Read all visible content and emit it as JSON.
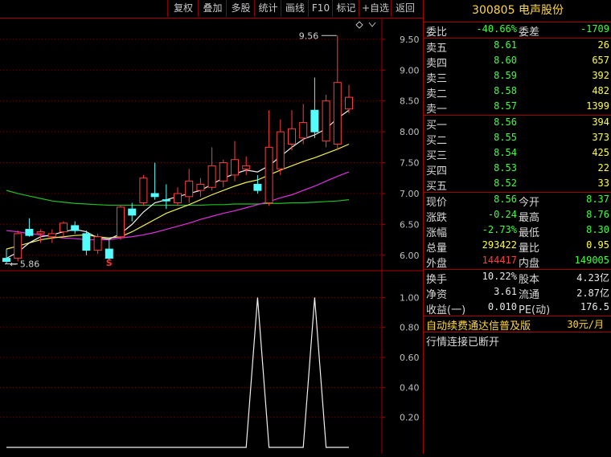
{
  "toolbar": {
    "buttons": [
      "复权",
      "叠加",
      "多股",
      "统计",
      "画线",
      "F10",
      "标记",
      "+自选",
      "返回"
    ]
  },
  "chart": {
    "price_axis_labels": [
      "9.50",
      "9.00",
      "8.50",
      "8.00",
      "7.50",
      "7.00",
      "6.50",
      "6.00"
    ],
    "indicator_axis_labels": [
      "1.00",
      "0.80",
      "0.60",
      "0.40",
      "0.20"
    ],
    "high_marker": "9.56",
    "low_marker": "5.86",
    "signal_marker": "S"
  },
  "chart_data": {
    "type": "candlestick",
    "candles": [
      {
        "o": 5.95,
        "h": 6.1,
        "l": 5.86,
        "c": 5.9
      },
      {
        "o": 5.95,
        "h": 6.4,
        "l": 5.9,
        "c": 6.35
      },
      {
        "o": 6.42,
        "h": 6.6,
        "l": 6.3,
        "c": 6.32
      },
      {
        "o": 6.35,
        "h": 6.42,
        "l": 6.2,
        "c": 6.38
      },
      {
        "o": 6.3,
        "h": 6.42,
        "l": 6.2,
        "c": 6.35
      },
      {
        "o": 6.38,
        "h": 6.55,
        "l": 6.3,
        "c": 6.52
      },
      {
        "o": 6.48,
        "h": 6.55,
        "l": 6.35,
        "c": 6.4
      },
      {
        "o": 6.35,
        "h": 6.4,
        "l": 6.0,
        "c": 6.08
      },
      {
        "o": 6.08,
        "h": 6.35,
        "l": 6.02,
        "c": 6.3
      },
      {
        "o": 6.1,
        "h": 6.25,
        "l": 5.92,
        "c": 5.95
      },
      {
        "o": 6.3,
        "h": 6.8,
        "l": 6.25,
        "c": 6.78
      },
      {
        "o": 6.75,
        "h": 6.85,
        "l": 6.55,
        "c": 6.65
      },
      {
        "o": 6.85,
        "h": 7.3,
        "l": 6.8,
        "c": 7.25
      },
      {
        "o": 7.0,
        "h": 7.5,
        "l": 6.9,
        "c": 6.95
      },
      {
        "o": 6.9,
        "h": 7.15,
        "l": 6.75,
        "c": 6.88
      },
      {
        "o": 6.85,
        "h": 7.1,
        "l": 6.8,
        "c": 7.0
      },
      {
        "o": 6.95,
        "h": 7.4,
        "l": 6.85,
        "c": 7.2
      },
      {
        "o": 7.05,
        "h": 7.25,
        "l": 6.95,
        "c": 7.15
      },
      {
        "o": 7.1,
        "h": 7.75,
        "l": 7.05,
        "c": 7.45
      },
      {
        "o": 7.2,
        "h": 7.55,
        "l": 7.1,
        "c": 7.5
      },
      {
        "o": 7.3,
        "h": 7.85,
        "l": 7.2,
        "c": 7.55
      },
      {
        "o": 7.4,
        "h": 7.6,
        "l": 7.3,
        "c": 7.45
      },
      {
        "o": 7.15,
        "h": 7.3,
        "l": 7.0,
        "c": 7.05
      },
      {
        "o": 6.85,
        "h": 8.35,
        "l": 6.8,
        "c": 7.75
      },
      {
        "o": 7.4,
        "h": 8.2,
        "l": 7.3,
        "c": 8.0
      },
      {
        "o": 7.8,
        "h": 8.35,
        "l": 7.7,
        "c": 8.05
      },
      {
        "o": 7.9,
        "h": 8.45,
        "l": 7.8,
        "c": 8.15
      },
      {
        "o": 8.35,
        "h": 8.88,
        "l": 7.9,
        "c": 8.0
      },
      {
        "o": 7.85,
        "h": 8.6,
        "l": 7.75,
        "c": 8.5
      },
      {
        "o": 7.8,
        "h": 9.56,
        "l": 7.7,
        "c": 8.8
      },
      {
        "o": 8.37,
        "h": 8.76,
        "l": 8.3,
        "c": 8.56
      }
    ],
    "ma_white": [
      5.95,
      6.05,
      6.2,
      6.3,
      6.33,
      6.38,
      6.42,
      6.38,
      6.28,
      6.26,
      6.35,
      6.5,
      6.7,
      6.85,
      6.9,
      6.95,
      7.0,
      7.05,
      7.15,
      7.25,
      7.32,
      7.38,
      7.35,
      7.45,
      7.6,
      7.75,
      7.88,
      7.95,
      8.05,
      8.22,
      8.35
    ],
    "ma_yellow": [
      6.1,
      6.15,
      6.2,
      6.25,
      6.28,
      6.3,
      6.32,
      6.33,
      6.3,
      6.28,
      6.3,
      6.38,
      6.48,
      6.58,
      6.68,
      6.75,
      6.82,
      6.9,
      6.98,
      7.05,
      7.12,
      7.18,
      7.22,
      7.3,
      7.38,
      7.45,
      7.52,
      7.58,
      7.65,
      7.72,
      7.8
    ],
    "ma_magenta": [
      6.4,
      6.38,
      6.35,
      6.33,
      6.3,
      6.28,
      6.27,
      6.25,
      6.25,
      6.25,
      6.28,
      6.3,
      6.33,
      6.37,
      6.42,
      6.47,
      6.52,
      6.58,
      6.63,
      6.68,
      6.72,
      6.77,
      6.82,
      6.87,
      6.93,
      6.98,
      7.05,
      7.12,
      7.2,
      7.28,
      7.35
    ],
    "ma_green": [
      7.05,
      7.0,
      6.96,
      6.92,
      6.88,
      6.86,
      6.84,
      6.83,
      6.82,
      6.81,
      6.81,
      6.81,
      6.81,
      6.81,
      6.81,
      6.81,
      6.81,
      6.81,
      6.82,
      6.82,
      6.83,
      6.83,
      6.83,
      6.84,
      6.84,
      6.85,
      6.85,
      6.86,
      6.87,
      6.88,
      6.9
    ],
    "indicator": [
      0,
      0,
      0,
      0,
      0,
      0,
      0,
      0,
      0,
      0,
      0,
      0,
      0,
      0,
      0,
      0,
      0,
      0,
      0,
      0,
      0,
      0,
      1,
      0,
      0,
      0,
      0,
      1,
      0,
      0,
      0
    ],
    "ylim": [
      5.75,
      9.85
    ],
    "indicator_ylim": [
      0,
      1.12
    ]
  },
  "quote": {
    "title": "300805 电声股份",
    "weibi_label": "委比",
    "weibi_value": "-40.66%",
    "weicha_label": "委差",
    "weicha_value": "-1709",
    "sells": [
      {
        "label": "卖五",
        "price": "8.61",
        "vol": "26"
      },
      {
        "label": "卖四",
        "price": "8.60",
        "vol": "657"
      },
      {
        "label": "卖三",
        "price": "8.59",
        "vol": "392"
      },
      {
        "label": "卖二",
        "price": "8.58",
        "vol": "482"
      },
      {
        "label": "卖一",
        "price": "8.57",
        "vol": "1399"
      }
    ],
    "buys": [
      {
        "label": "买一",
        "price": "8.56",
        "vol": "394"
      },
      {
        "label": "买二",
        "price": "8.55",
        "vol": "373"
      },
      {
        "label": "买三",
        "price": "8.54",
        "vol": "425"
      },
      {
        "label": "买四",
        "price": "8.53",
        "vol": "22"
      },
      {
        "label": "买五",
        "price": "8.52",
        "vol": "33"
      }
    ],
    "stats": [
      {
        "l1": "现价",
        "v1": "8.56",
        "c1": "green",
        "l2": "今开",
        "v2": "8.37",
        "c2": "green"
      },
      {
        "l1": "涨跌",
        "v1": "-0.24",
        "c1": "green",
        "l2": "最高",
        "v2": "8.76",
        "c2": "green"
      },
      {
        "l1": "涨幅",
        "v1": "-2.73%",
        "c1": "green",
        "l2": "最低",
        "v2": "8.30",
        "c2": "green"
      },
      {
        "l1": "总量",
        "v1": "293422",
        "c1": "yellow",
        "l2": "量比",
        "v2": "0.95",
        "c2": "yellow"
      },
      {
        "l1": "外盘",
        "v1": "144417",
        "c1": "red",
        "l2": "内盘",
        "v2": "149005",
        "c2": "green"
      }
    ],
    "fund": [
      {
        "l1": "换手",
        "v1": "10.22%",
        "l2": "股本",
        "v2": "4.23亿"
      },
      {
        "l1": "净资",
        "v1": "3.61",
        "l2": "流通",
        "v2": "2.87亿"
      },
      {
        "l1": "收益(一)",
        "v1": "0.010",
        "l2": "PE(动)",
        "v2": "176.5"
      }
    ],
    "promo_text": "自动续费通达信普及版",
    "promo_price": "30元/月",
    "status_text": "行情连接已断开"
  },
  "colors": {
    "up": "#ff3c3c",
    "down": "#54fcfc",
    "border": "#aa0000"
  }
}
